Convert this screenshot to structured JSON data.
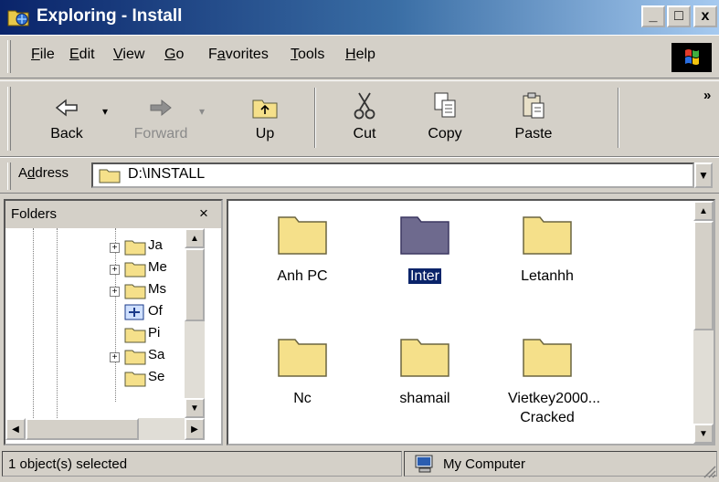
{
  "window": {
    "title": "Exploring - Install"
  },
  "caption_buttons": {
    "minimize": "_",
    "maximize": "□",
    "close": "x"
  },
  "menu": [
    {
      "pre": "",
      "key": "F",
      "post": "ile"
    },
    {
      "pre": "",
      "key": "E",
      "post": "dit"
    },
    {
      "pre": "",
      "key": "V",
      "post": "iew"
    },
    {
      "pre": "",
      "key": "G",
      "post": "o"
    },
    {
      "pre": "F",
      "key": "a",
      "post": "vorites"
    },
    {
      "pre": "",
      "key": "T",
      "post": "ools"
    },
    {
      "pre": "",
      "key": "H",
      "post": "elp"
    }
  ],
  "toolbar": {
    "back": "Back",
    "forward": "Forward",
    "up": "Up",
    "cut": "Cut",
    "copy": "Copy",
    "paste": "Paste",
    "more": "»"
  },
  "address": {
    "label_pre": "A",
    "label_key": "d",
    "label_post": "dress",
    "value": "D:\\INSTALL"
  },
  "folders_pane": {
    "title": "Folders",
    "close": "×",
    "items": [
      "Ja",
      "Me",
      "Ms",
      "Of",
      "Pi",
      "Sa",
      "Se"
    ]
  },
  "content": {
    "items": [
      {
        "label": "Anh PC",
        "selected": false
      },
      {
        "label": "Inter",
        "selected": true
      },
      {
        "label": "Letanhh",
        "selected": false
      },
      {
        "label": "Nc",
        "selected": false
      },
      {
        "label": "shamail",
        "selected": false
      },
      {
        "label": "Vietkey2000... Cracked",
        "selected": false
      }
    ]
  },
  "status": {
    "selection": "1 object(s) selected",
    "location": "My Computer"
  },
  "colors": {
    "titlebar_start": "#0a246a",
    "titlebar_end": "#a6caf0",
    "folder": "#f5e08a",
    "selected_folder": "#6e6a8e",
    "selection": "#0a246a"
  }
}
